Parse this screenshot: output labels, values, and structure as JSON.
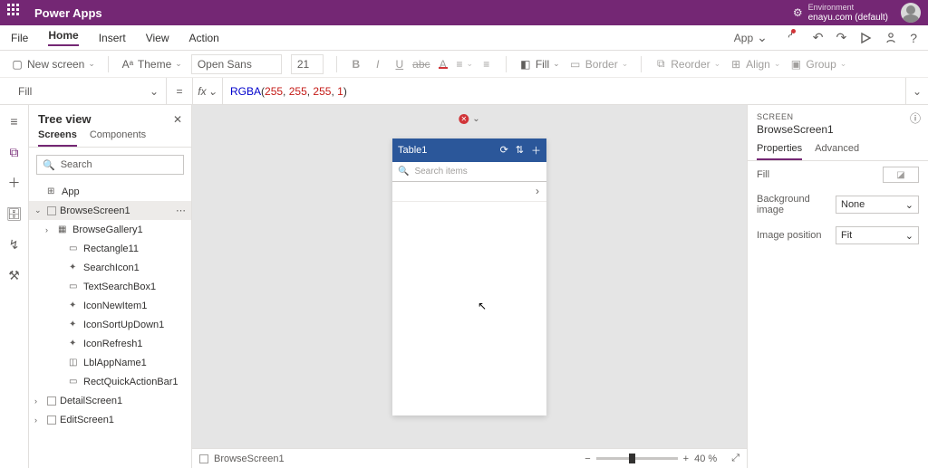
{
  "header": {
    "title": "Power Apps",
    "env_label": "Environment",
    "env_name": "enayu.com (default)"
  },
  "menu": {
    "file": "File",
    "home": "Home",
    "insert": "Insert",
    "view": "View",
    "action": "Action",
    "app": "App"
  },
  "toolbar": {
    "new_screen": "New screen",
    "theme": "Theme",
    "font": "Open Sans",
    "font_size": "21",
    "fill": "Fill",
    "border": "Border",
    "reorder": "Reorder",
    "align": "Align",
    "group": "Group"
  },
  "formula": {
    "property": "Fill",
    "fn": "RGBA",
    "a1": "255",
    "a2": "255",
    "a3": "255",
    "a4": "1"
  },
  "tree": {
    "title": "Tree view",
    "tab_screens": "Screens",
    "tab_components": "Components",
    "search_placeholder": "Search",
    "app": "App",
    "items": {
      "browse_screen": "BrowseScreen1",
      "browse_gallery": "BrowseGallery1",
      "rectangle": "Rectangle11",
      "search_icon": "SearchIcon1",
      "text_search": "TextSearchBox1",
      "icon_new": "IconNewItem1",
      "icon_sort": "IconSortUpDown1",
      "icon_refresh": "IconRefresh1",
      "lbl_app": "LblAppName1",
      "rect_quick": "RectQuickActionBar1",
      "detail_screen": "DetailScreen1",
      "edit_screen": "EditScreen1"
    }
  },
  "phone": {
    "title": "Table1",
    "search_placeholder": "Search items"
  },
  "canvas_status": {
    "screen": "BrowseScreen1",
    "zoom": "40 %"
  },
  "props": {
    "section": "SCREEN",
    "name": "BrowseScreen1",
    "tab_props": "Properties",
    "tab_adv": "Advanced",
    "fill_label": "Fill",
    "bg_label": "Background image",
    "bg_value": "None",
    "pos_label": "Image position",
    "pos_value": "Fit"
  }
}
